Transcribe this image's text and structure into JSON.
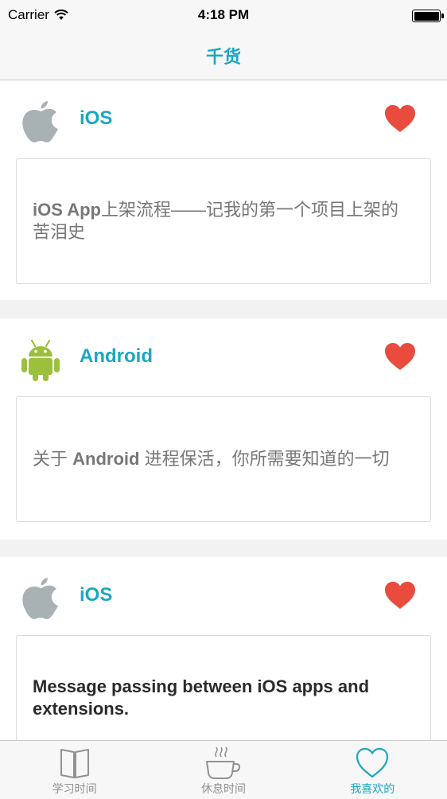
{
  "status_bar": {
    "carrier": "Carrier",
    "time": "4:18 PM",
    "battery_level": 1.0
  },
  "nav": {
    "title": "千货"
  },
  "colors": {
    "accent": "#1aa7c4",
    "heart": "#e94b3c",
    "apple_gray": "#a8b1b3",
    "android_green": "#9bc03c"
  },
  "cards": [
    {
      "platform": "iOS",
      "icon": "apple-icon",
      "favorited": true,
      "title_parts": [
        {
          "text": "iOS App",
          "bold": true
        },
        {
          "text": "上架流程——记我的第一个项目上架的苦泪史",
          "bold": false
        }
      ]
    },
    {
      "platform": "Android",
      "icon": "android-icon",
      "favorited": true,
      "title_parts": [
        {
          "text": "关于 ",
          "bold": false
        },
        {
          "text": "Android",
          "bold": true
        },
        {
          "text": " 进程保活，你所需要知道的一切",
          "bold": false
        }
      ]
    },
    {
      "platform": "iOS",
      "icon": "apple-icon",
      "favorited": true,
      "title": "Message passing between iOS apps and extensions."
    }
  ],
  "tabs": [
    {
      "label": "学习时间",
      "icon": "book-icon",
      "active": false
    },
    {
      "label": "休息时间",
      "icon": "coffee-cup-icon",
      "active": false
    },
    {
      "label": "我喜欢的",
      "icon": "heart-outline-icon",
      "active": true
    }
  ]
}
